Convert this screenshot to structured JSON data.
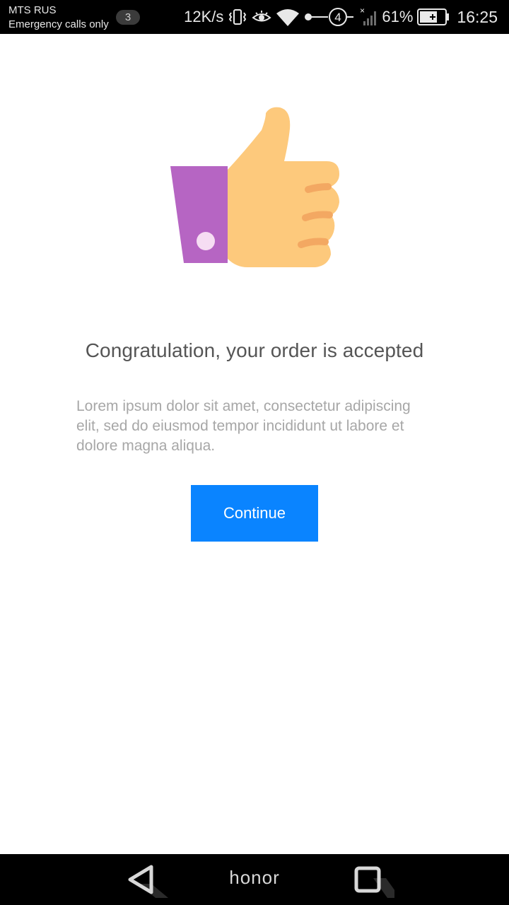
{
  "status_bar": {
    "carrier": "MTS RUS",
    "emergency": "Emergency calls only",
    "notification_count": "3",
    "network_speed": "12K/s",
    "sim_slot": "4",
    "battery_percent": "61%",
    "time": "16:25",
    "icons": [
      "vibrate-icon",
      "eye-comfort-icon",
      "wifi-icon",
      "sim-slot-icon",
      "signal-icon",
      "battery-icon"
    ]
  },
  "main": {
    "hero_icon": "thumbs-up-icon",
    "title": "Congratulation, your order is accepted",
    "description": "Lorem ipsum dolor sit amet, consectetur adipiscing elit, sed do eiusmod tempor incididunt ut labore et dolore magna aliqua.",
    "continue_label": "Continue"
  },
  "nav_bar": {
    "brand": "honor",
    "icons": [
      "back-icon",
      "recent-apps-icon"
    ]
  },
  "colors": {
    "accent": "#0a84ff",
    "sleeve": "#b665c3",
    "hand": "#fdc97c",
    "finger_crease": "#f3a862",
    "title_text": "#555555",
    "body_text": "#a7a7a7"
  }
}
